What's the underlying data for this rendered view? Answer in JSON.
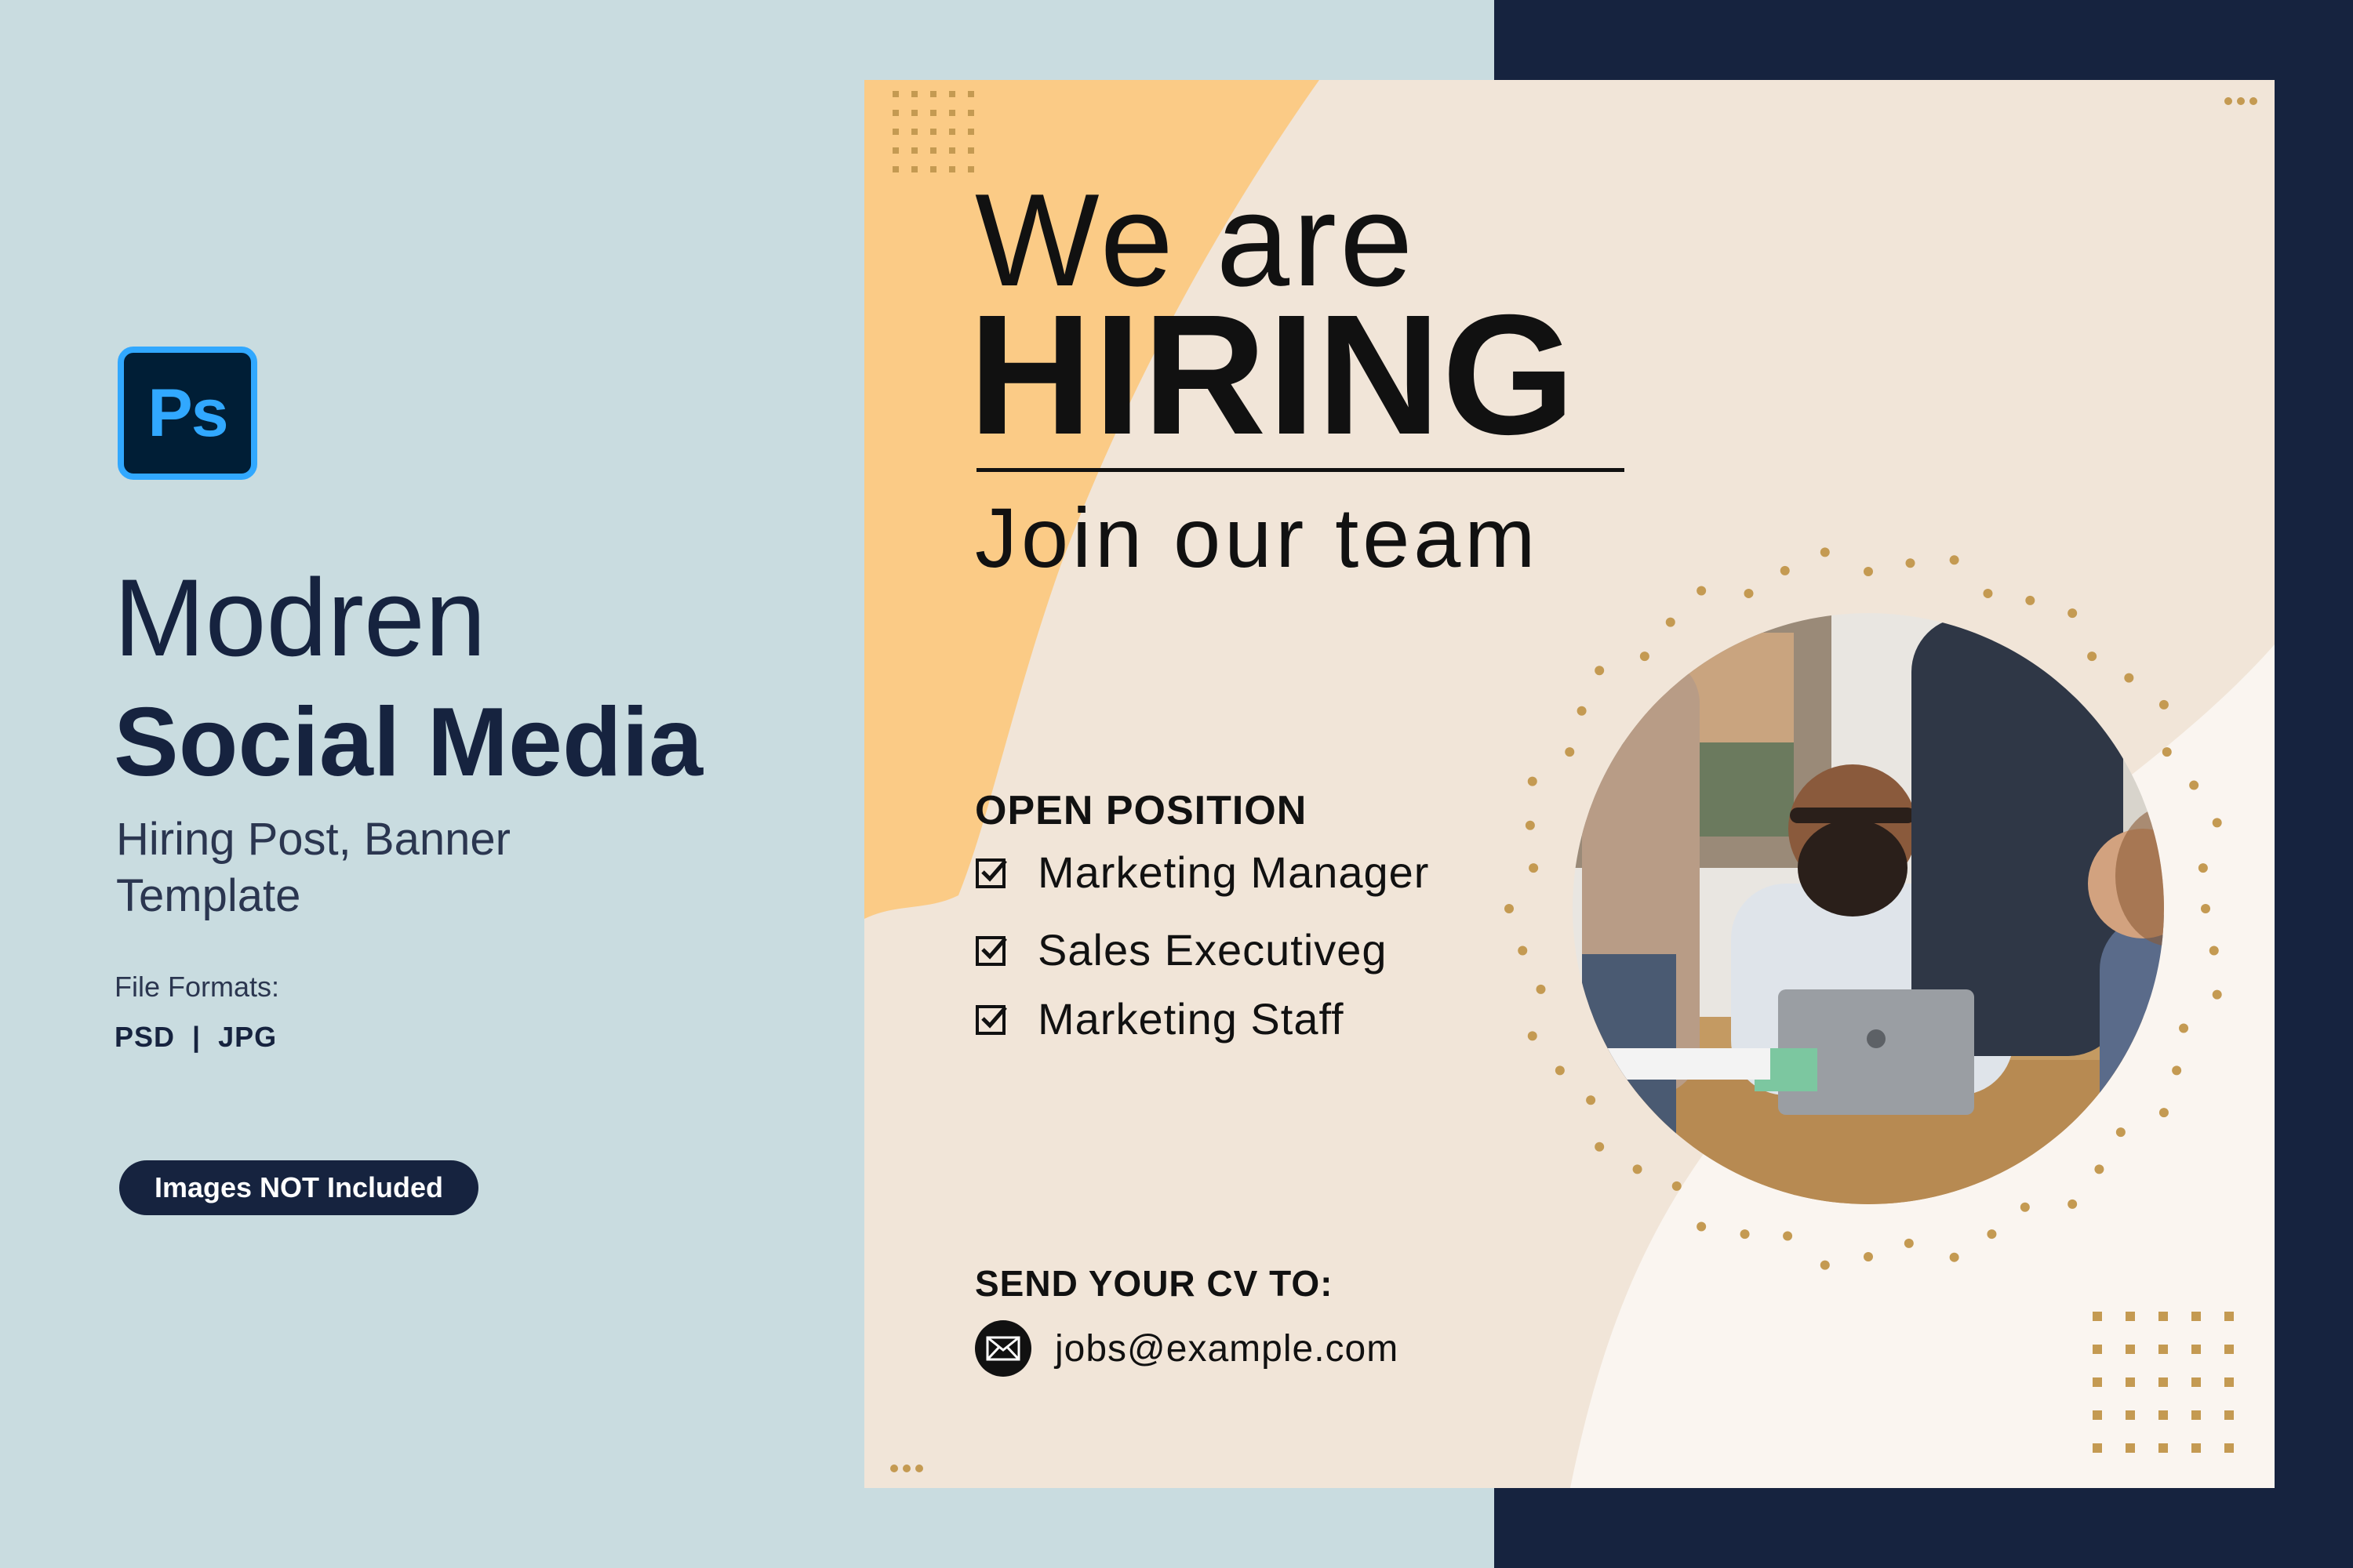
{
  "left": {
    "logo_text": "Ps",
    "title_line1": "Modren",
    "title_line2": "Social Media",
    "subtitle": "Hiring Post, Banner Template",
    "formats_label": "File Formats:",
    "formats_value": "PSD  |  JPG",
    "badge": "Images NOT Included"
  },
  "card": {
    "headline_line1": "We are",
    "headline_line2": "HIRING",
    "headline_line3": "Join our team",
    "open_position_title": "OPEN POSITION",
    "positions": [
      "Marketing Manager",
      "Sales Executiveg",
      "Marketing Staff"
    ],
    "cv_title": "SEND YOUR CV TO:",
    "email": "jobs@example.com"
  },
  "colors": {
    "left_bg": "#c9dce0",
    "navy": "#16233f",
    "card_beige": "#f1e5d8",
    "card_orange": "#fbcb86",
    "card_cream": "#faf5f0",
    "dot_gold": "#c49a52",
    "photoshop_blue": "#31a8ff"
  }
}
